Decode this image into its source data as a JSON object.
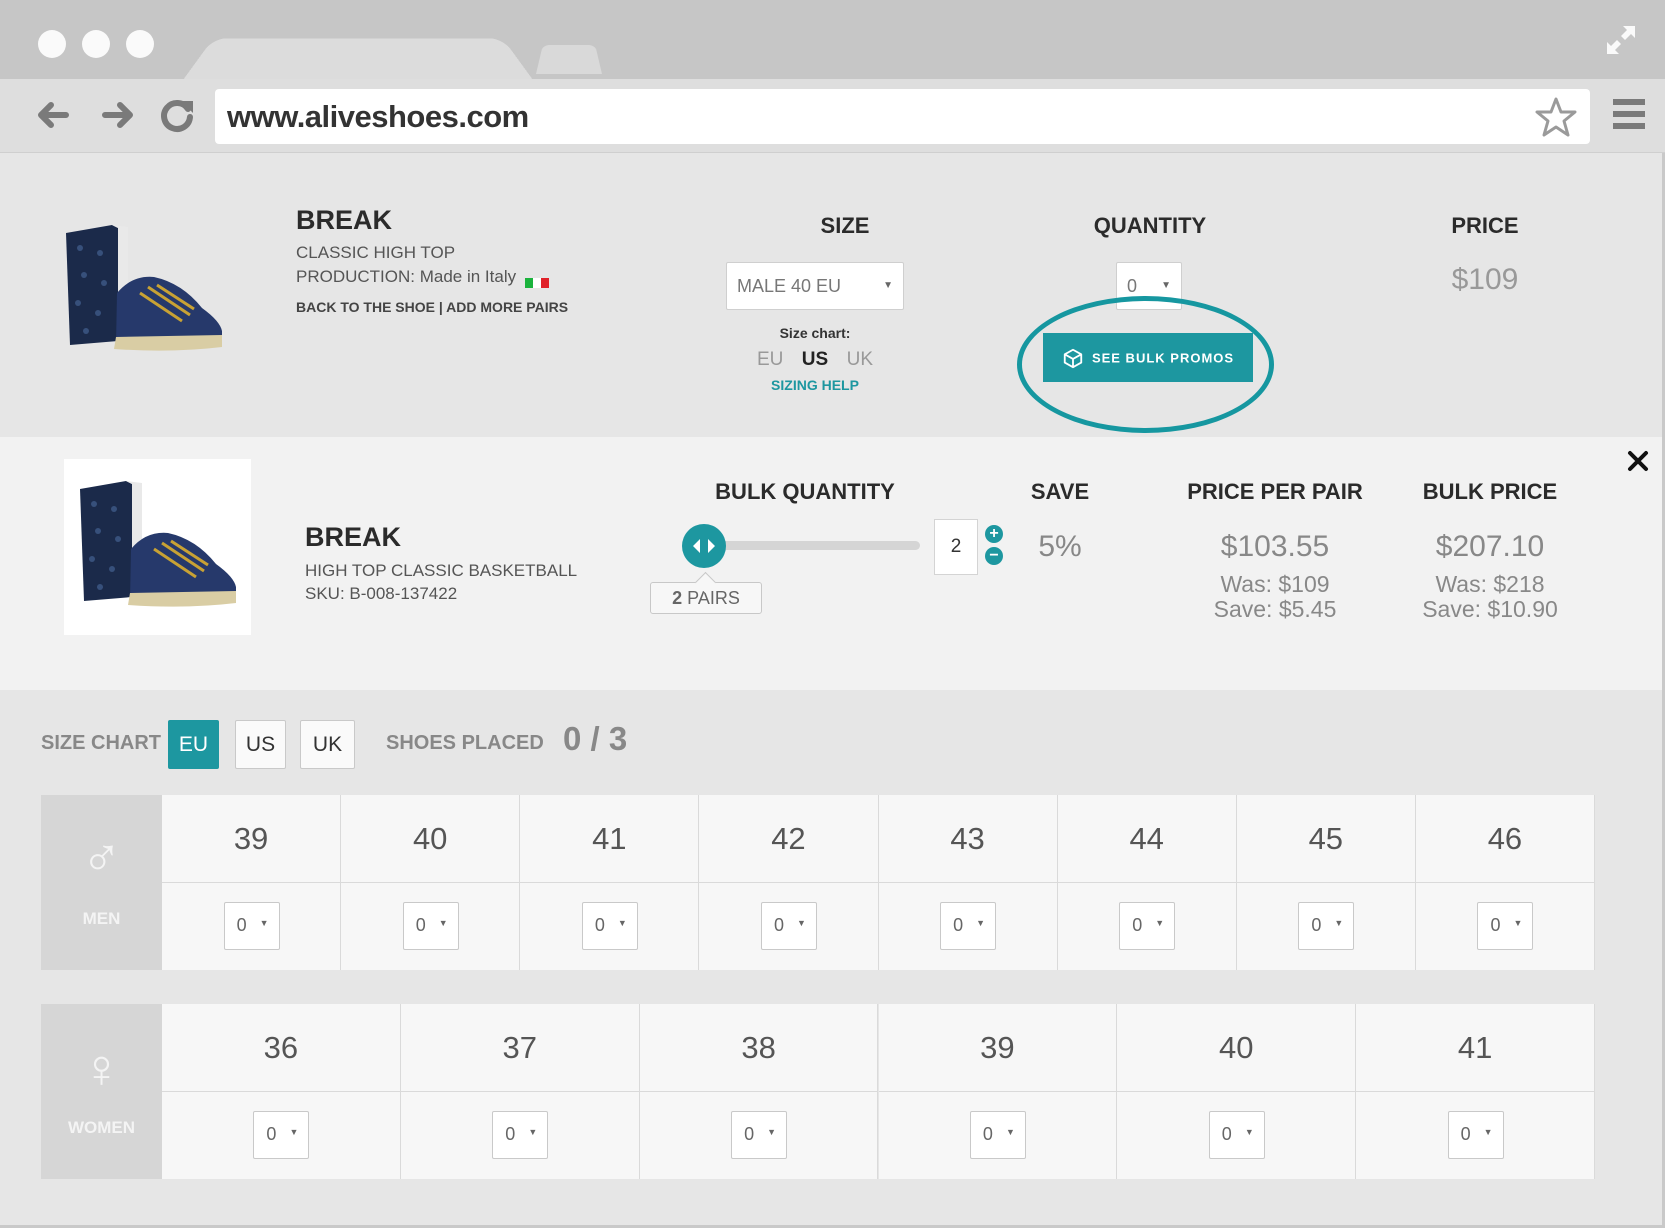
{
  "browser": {
    "url": "www.aliveshoes.com"
  },
  "product": {
    "name": "BREAK",
    "line1": "CLASSIC HIGH TOP",
    "production_label": "PRODUCTION:",
    "production_value": "Made in Italy",
    "link_back": "BACK TO THE SHOE",
    "link_separator": "|",
    "link_add": "ADD MORE PAIRS",
    "size_header": "SIZE",
    "size_value": "MALE 40 EU",
    "size_chart_label": "Size chart:",
    "size_chart_options": [
      "EU",
      "US",
      "UK"
    ],
    "size_chart_selected": "US",
    "sizing_help": "SIZING HELP",
    "quantity_header": "QUANTITY",
    "quantity_value": "0",
    "bulk_button": "SEE BULK PROMOS",
    "price_header": "PRICE",
    "price_value": "$109"
  },
  "bulk": {
    "name": "BREAK",
    "line1": "HIGH TOP CLASSIC BASKETBALL",
    "sku": "SKU: B-008-137422",
    "quantity_header": "BULK QUANTITY",
    "slider_fraction": 0.0,
    "pairs_count": "2",
    "pairs_label": "PAIRS",
    "quantity_value": "2",
    "plus": "+",
    "minus": "−",
    "save_header": "SAVE",
    "save_value": "5%",
    "ppp_header": "PRICE PER PAIR",
    "ppp_value": "$103.55",
    "ppp_was": "Was: $109",
    "ppp_save": "Save: $5.45",
    "bulk_header": "BULK PRICE",
    "bulk_value": "$207.10",
    "bulk_was": "Was: $218",
    "bulk_save": "Save: $10.90"
  },
  "sizechart": {
    "label": "SIZE CHART",
    "options": [
      "EU",
      "US",
      "UK"
    ],
    "selected": "EU",
    "placed_label": "SHOES PLACED",
    "placed_value": "0 / 3",
    "men": {
      "label": "MEN",
      "symbol": "♂",
      "sizes": [
        "39",
        "40",
        "41",
        "42",
        "43",
        "44",
        "45",
        "46"
      ],
      "quantities": [
        "0",
        "0",
        "0",
        "0",
        "0",
        "0",
        "0",
        "0"
      ]
    },
    "women": {
      "label": "WOMEN",
      "symbol": "♀",
      "sizes": [
        "36",
        "37",
        "38",
        "39",
        "40",
        "41"
      ],
      "quantities": [
        "0",
        "0",
        "0",
        "0",
        "0",
        "0"
      ]
    }
  },
  "colors": {
    "accent": "#1d97a0",
    "flag_green": "#1bb33d",
    "flag_red": "#e0222a"
  }
}
